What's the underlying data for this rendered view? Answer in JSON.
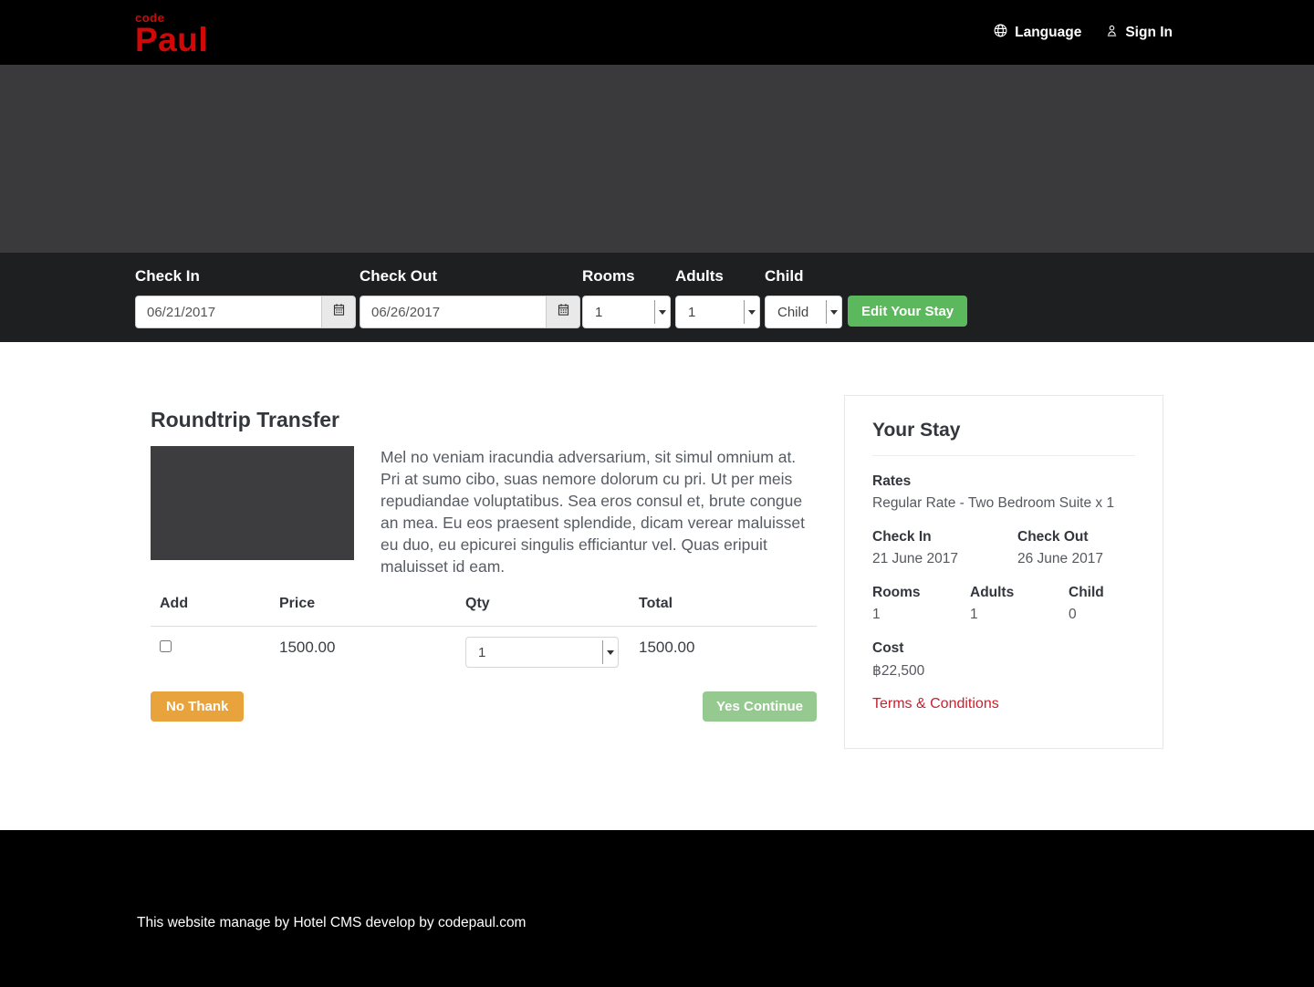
{
  "header": {
    "logo_top": "code",
    "logo_main": "Paul",
    "language_label": "Language",
    "sign_in_label": "Sign In"
  },
  "booking_bar": {
    "check_in": {
      "label": "Check In",
      "value": "06/21/2017"
    },
    "check_out": {
      "label": "Check Out",
      "value": "06/26/2017"
    },
    "rooms": {
      "label": "Rooms",
      "value": "1"
    },
    "adults": {
      "label": "Adults",
      "value": "1"
    },
    "child": {
      "label": "Child",
      "value": "Child"
    },
    "edit_button": "Edit Your Stay"
  },
  "main": {
    "title": "Roundtrip Transfer",
    "description": "Mel no veniam iracundia adversarium, sit simul omnium at. Pri at sumo cibo, suas nemore dolorum cu pri. Ut per meis repudiandae voluptatibus. Sea eros consul et, brute congue an mea. Eu eos praesent splendide, dicam verear maluisset eu duo, eu epicurei singulis efficiantur vel. Quas eripuit maluisset id eam.",
    "table": {
      "headers": [
        "Add",
        "Price",
        "Qty",
        "Total"
      ],
      "row": {
        "price": "1500.00",
        "qty": "1",
        "total": "1500.00"
      }
    },
    "no_button": "No Thank",
    "yes_button": "Yes Continue"
  },
  "sidebar": {
    "title": "Your Stay",
    "rates_label": "Rates",
    "rates_value": "Regular Rate - Two Bedroom Suite x 1",
    "check_in_label": "Check In",
    "check_in_value": "21 June 2017",
    "check_out_label": "Check Out",
    "check_out_value": "26 June 2017",
    "rooms_label": "Rooms",
    "rooms_value": "1",
    "adults_label": "Adults",
    "adults_value": "1",
    "child_label": "Child",
    "child_value": "0",
    "cost_label": "Cost",
    "cost_value": "฿22,500",
    "terms_link": "Terms & Conditions"
  },
  "footer": {
    "text": "This website manage by Hotel CMS develop by codepaul.com"
  },
  "colors": {
    "brand_red": "#d10808",
    "button_green": "#5cb85c",
    "button_light_green": "#96c98f",
    "button_orange": "#e9a33d",
    "link_red": "#cb202d",
    "hero_gray": "#3a3a3c",
    "bar_gray": "#1e1f21"
  }
}
